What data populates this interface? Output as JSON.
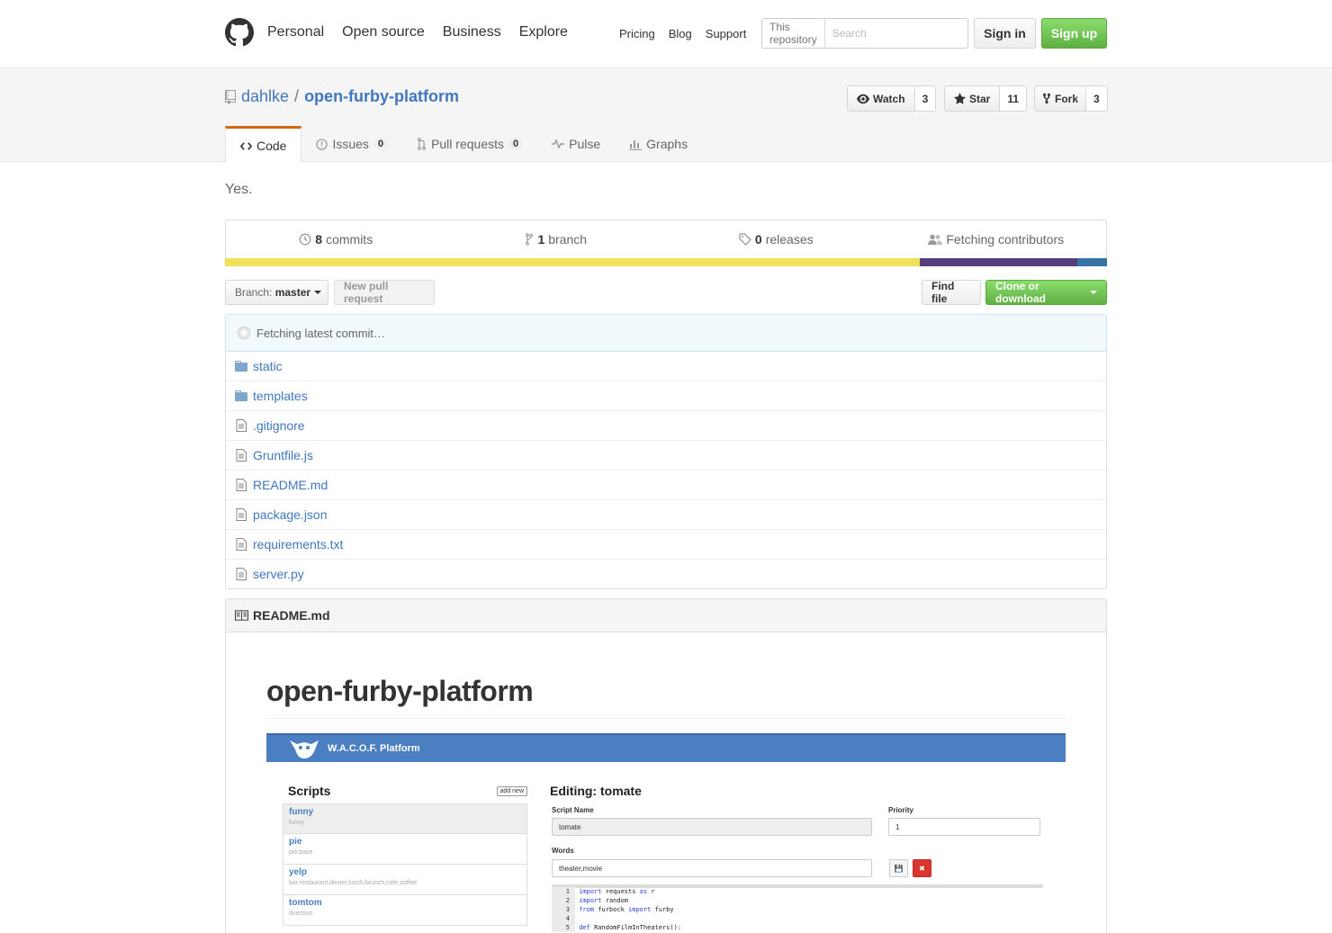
{
  "header": {
    "nav_main": [
      "Personal",
      "Open source",
      "Business",
      "Explore"
    ],
    "nav_sub": [
      "Pricing",
      "Blog",
      "Support"
    ],
    "search_scope": "This repository",
    "search_placeholder": "Search",
    "signin": "Sign in",
    "signup": "Sign up"
  },
  "repo": {
    "owner": "dahlke",
    "separator": "/",
    "name": "open-furby-platform",
    "watch_label": "Watch",
    "watch_count": "3",
    "star_label": "Star",
    "star_count": "11",
    "fork_label": "Fork",
    "fork_count": "3",
    "tabs": [
      {
        "label": "Code",
        "icon": "code-icon"
      },
      {
        "label": "Issues",
        "icon": "issue-icon",
        "count": "0"
      },
      {
        "label": "Pull requests",
        "icon": "pull-request-icon",
        "count": "0"
      },
      {
        "label": "Pulse",
        "icon": "pulse-icon"
      },
      {
        "label": "Graphs",
        "icon": "graph-icon"
      }
    ],
    "description": "Yes."
  },
  "summary": {
    "commits_num": "8",
    "commits_label": "commits",
    "branches_num": "1",
    "branches_label": "branch",
    "releases_num": "0",
    "releases_label": "releases",
    "contributors_label": "Fetching contributors",
    "lang_colors": [
      "#f1e05a",
      "#563d7c",
      "#3572A5"
    ],
    "lang_shares": [
      0.788,
      0.178,
      0.034
    ]
  },
  "file_nav": {
    "branch_label": "Branch:",
    "branch_value": "master",
    "new_pr": "New pull request",
    "find_file": "Find file",
    "clone": "Clone or download"
  },
  "commit_bar": "Fetching latest commit…",
  "files": [
    {
      "name": "static",
      "type": "dir"
    },
    {
      "name": "templates",
      "type": "dir"
    },
    {
      "name": ".gitignore",
      "type": "file"
    },
    {
      "name": "Gruntfile.js",
      "type": "file"
    },
    {
      "name": "README.md",
      "type": "file"
    },
    {
      "name": "package.json",
      "type": "file"
    },
    {
      "name": "requirements.txt",
      "type": "file"
    },
    {
      "name": "server.py",
      "type": "file"
    }
  ],
  "readme": {
    "filename": "README.md",
    "heading": "open-furby-platform",
    "screenshot": {
      "app_title": "W.A.C.O.F. Platform",
      "scripts_heading": "Scripts",
      "add_new": "add new",
      "scripts": [
        {
          "title": "funny",
          "sub": "funny",
          "active": true
        },
        {
          "title": "pie",
          "sub": "pie,bake",
          "active": false
        },
        {
          "title": "yelp",
          "sub": "bar,restaurant,dinner,lunch,brunch,cafe,coffee",
          "active": false
        },
        {
          "title": "tomtom",
          "sub": "direction",
          "active": false
        }
      ],
      "editing_heading": "Editing: tomate",
      "script_name_label": "Script Name",
      "script_name_value": "tomate",
      "priority_label": "Priority",
      "priority_value": "1",
      "words_label": "Words",
      "words_value": "theater,movie",
      "code_lines": [
        {
          "n": "1",
          "parts": [
            [
              "kw",
              "import"
            ],
            [
              "",
              "  requests "
            ],
            [
              "kw",
              "as"
            ],
            [
              "",
              "  r"
            ]
          ]
        },
        {
          "n": "2",
          "parts": [
            [
              "kw",
              "import"
            ],
            [
              "",
              "  random"
            ]
          ]
        },
        {
          "n": "3",
          "parts": [
            [
              "kw",
              "from"
            ],
            [
              "",
              "  furbock "
            ],
            [
              "kw",
              "import"
            ],
            [
              "",
              "  furby"
            ]
          ]
        },
        {
          "n": "4",
          "parts": []
        },
        {
          "n": "5",
          "parts": [
            [
              "kw",
              "def"
            ],
            [
              "",
              "  RandomFilmInTheaters():"
            ]
          ]
        }
      ]
    }
  }
}
